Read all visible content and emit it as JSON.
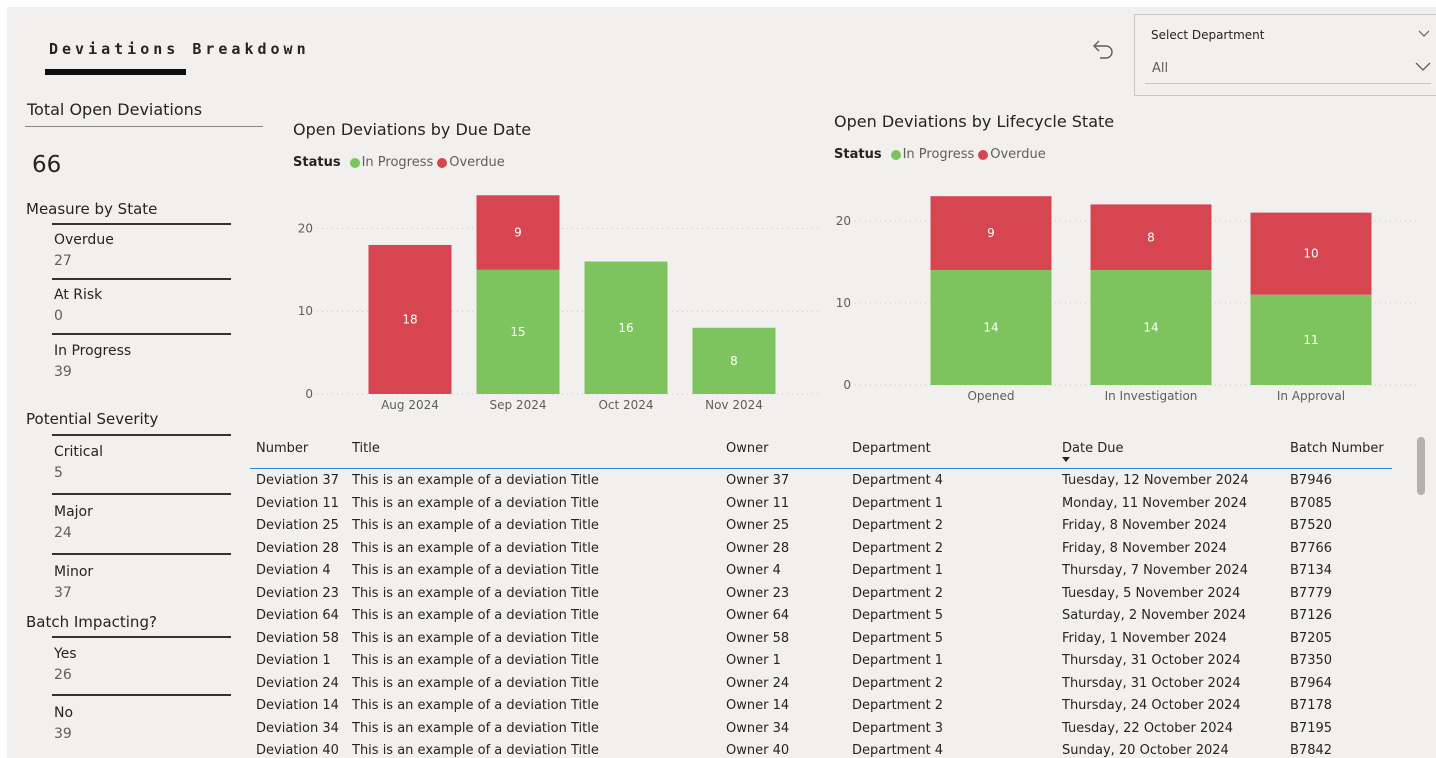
{
  "page": {
    "title": "Deviations Breakdown"
  },
  "slicer": {
    "label": "Select Department",
    "value": "All"
  },
  "total_open": {
    "title": "Total Open Deviations",
    "value": "66"
  },
  "measure_by_state": {
    "title": "Measure by State",
    "items": [
      {
        "label": "Overdue",
        "value": "27"
      },
      {
        "label": "At Risk",
        "value": "0"
      },
      {
        "label": "In Progress",
        "value": "39"
      }
    ]
  },
  "severity": {
    "title": "Potential Severity",
    "items": [
      {
        "label": "Critical",
        "value": "5"
      },
      {
        "label": "Major",
        "value": "24"
      },
      {
        "label": "Minor",
        "value": "37"
      }
    ]
  },
  "batch": {
    "title": "Batch Impacting?",
    "items": [
      {
        "label": "Yes",
        "value": "26"
      },
      {
        "label": "No",
        "value": "39"
      }
    ]
  },
  "legend": {
    "status": "Status",
    "in_progress": "In Progress",
    "overdue": "Overdue"
  },
  "colors": {
    "in_progress": "#7dc35e",
    "overdue": "#d64550",
    "header_rule": "#2b88d8",
    "background": "#f1f0ee"
  },
  "chart_data": [
    {
      "type": "bar",
      "stacked": true,
      "title": "Open Deviations by Due Date",
      "categories": [
        "Aug 2024",
        "Sep 2024",
        "Oct 2024",
        "Nov 2024"
      ],
      "series": [
        {
          "name": "In Progress",
          "values": [
            0,
            15,
            16,
            8
          ]
        },
        {
          "name": "Overdue",
          "values": [
            18,
            9,
            0,
            0
          ]
        }
      ],
      "yticks": [
        0,
        10,
        20
      ],
      "ylim": [
        0,
        25
      ],
      "grid": true,
      "legend": "top-left"
    },
    {
      "type": "bar",
      "stacked": true,
      "title": "Open Deviations by Lifecycle State",
      "categories": [
        "Opened",
        "In Investigation",
        "In Approval"
      ],
      "series": [
        {
          "name": "In Progress",
          "values": [
            14,
            14,
            11
          ]
        },
        {
          "name": "Overdue",
          "values": [
            9,
            8,
            10
          ]
        }
      ],
      "yticks": [
        0,
        10,
        20
      ],
      "ylim": [
        0,
        24
      ],
      "grid": true,
      "legend": "top-left"
    }
  ],
  "table": {
    "columns": [
      "Number",
      "Title",
      "Owner",
      "Department",
      "Date Due",
      "Batch Number"
    ],
    "sorted_by": "Date Due",
    "rows": [
      [
        "Deviation 37",
        "This is an example of a deviation Title",
        "Owner 37",
        "Department 4",
        "Tuesday, 12 November 2024",
        "B7946"
      ],
      [
        "Deviation 11",
        "This is an example of a deviation Title",
        "Owner 11",
        "Department 1",
        "Monday, 11 November 2024",
        "B7085"
      ],
      [
        "Deviation 25",
        "This is an example of a deviation Title",
        "Owner 25",
        "Department 2",
        "Friday, 8 November 2024",
        "B7520"
      ],
      [
        "Deviation 28",
        "This is an example of a deviation Title",
        "Owner 28",
        "Department 2",
        "Friday, 8 November 2024",
        "B7766"
      ],
      [
        "Deviation 4",
        "This is an example of a deviation Title",
        "Owner 4",
        "Department 1",
        "Thursday, 7 November 2024",
        "B7134"
      ],
      [
        "Deviation 23",
        "This is an example of a deviation Title",
        "Owner 23",
        "Department 2",
        "Tuesday, 5 November 2024",
        "B7779"
      ],
      [
        "Deviation 64",
        "This is an example of a deviation Title",
        "Owner 64",
        "Department 5",
        "Saturday, 2 November 2024",
        "B7126"
      ],
      [
        "Deviation 58",
        "This is an example of a deviation Title",
        "Owner 58",
        "Department 5",
        "Friday, 1 November 2024",
        "B7205"
      ],
      [
        "Deviation 1",
        "This is an example of a deviation Title",
        "Owner 1",
        "Department 1",
        "Thursday, 31 October 2024",
        "B7350"
      ],
      [
        "Deviation 24",
        "This is an example of a deviation Title",
        "Owner 24",
        "Department 2",
        "Thursday, 31 October 2024",
        "B7964"
      ],
      [
        "Deviation 14",
        "This is an example of a deviation Title",
        "Owner 14",
        "Department 2",
        "Thursday, 24 October 2024",
        "B7178"
      ],
      [
        "Deviation 34",
        "This is an example of a deviation Title",
        "Owner 34",
        "Department 3",
        "Tuesday, 22 October 2024",
        "B7195"
      ],
      [
        "Deviation 40",
        "This is an example of a deviation Title",
        "Owner 40",
        "Department 4",
        "Sunday, 20 October 2024",
        "B7842"
      ]
    ]
  }
}
